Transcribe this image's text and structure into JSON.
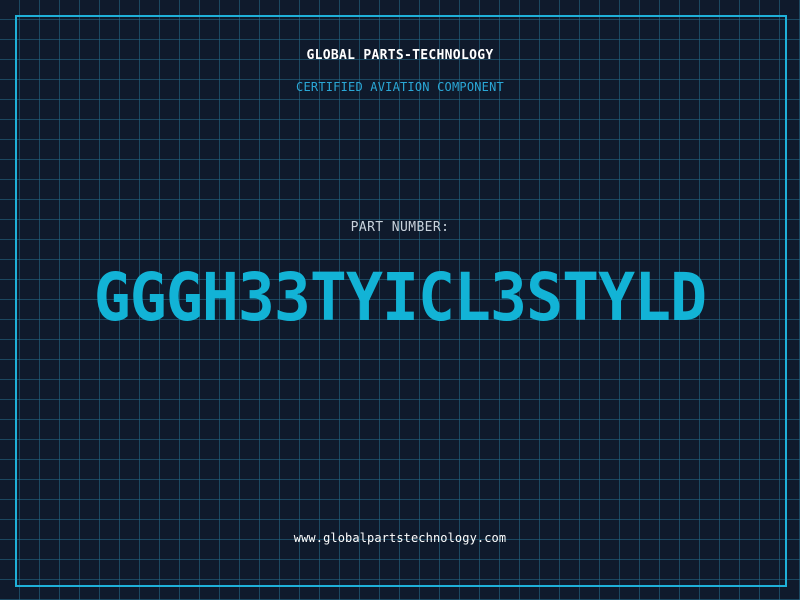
{
  "header": {
    "brand": "GLOBAL PARTS-TECHNOLOGY",
    "subtitle": "CERTIFIED AVIATION COMPONENT"
  },
  "part": {
    "label": "PART NUMBER:",
    "number": "GGGH33TYICL3STYLD"
  },
  "footer": {
    "website": "www.globalpartstechnology.com"
  },
  "colors": {
    "background": "#0f1a2c",
    "grid": "#266e8c",
    "accent": "#1fb0d8",
    "part_number": "#12b3d6"
  }
}
